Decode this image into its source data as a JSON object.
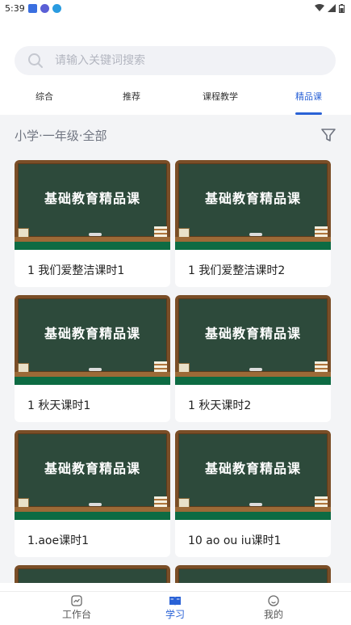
{
  "status_bar": {
    "time": "5:39"
  },
  "search": {
    "placeholder": "请输入关键词搜索"
  },
  "tabs": [
    {
      "label": "综合",
      "active": false
    },
    {
      "label": "推荐",
      "active": false
    },
    {
      "label": "课程教学",
      "active": false
    },
    {
      "label": "精品课",
      "active": true
    }
  ],
  "filter": {
    "label": "小学·一年级·全部",
    "icon": "filter-icon"
  },
  "cards": [
    {
      "thumbnail_text": "基础教育精品课",
      "title": "1 我们爱整洁课时1"
    },
    {
      "thumbnail_text": "基础教育精品课",
      "title": "1 我们爱整洁课时2"
    },
    {
      "thumbnail_text": "基础教育精品课",
      "title": "1 秋天课时1"
    },
    {
      "thumbnail_text": "基础教育精品课",
      "title": "1 秋天课时2"
    },
    {
      "thumbnail_text": "基础教育精品课",
      "title": "1.aoe课时1"
    },
    {
      "thumbnail_text": "基础教育精品课",
      "title": "10  ao ou iu课时1"
    }
  ],
  "bottom_nav": [
    {
      "label": "工作台",
      "icon": "workbench-icon",
      "active": false
    },
    {
      "label": "学习",
      "icon": "study-icon",
      "active": true
    },
    {
      "label": "我的",
      "icon": "profile-icon",
      "active": false
    }
  ],
  "colors": {
    "accent": "#2a62d6",
    "board": "#2d4a3b",
    "page_bg": "#f3f4f6"
  }
}
